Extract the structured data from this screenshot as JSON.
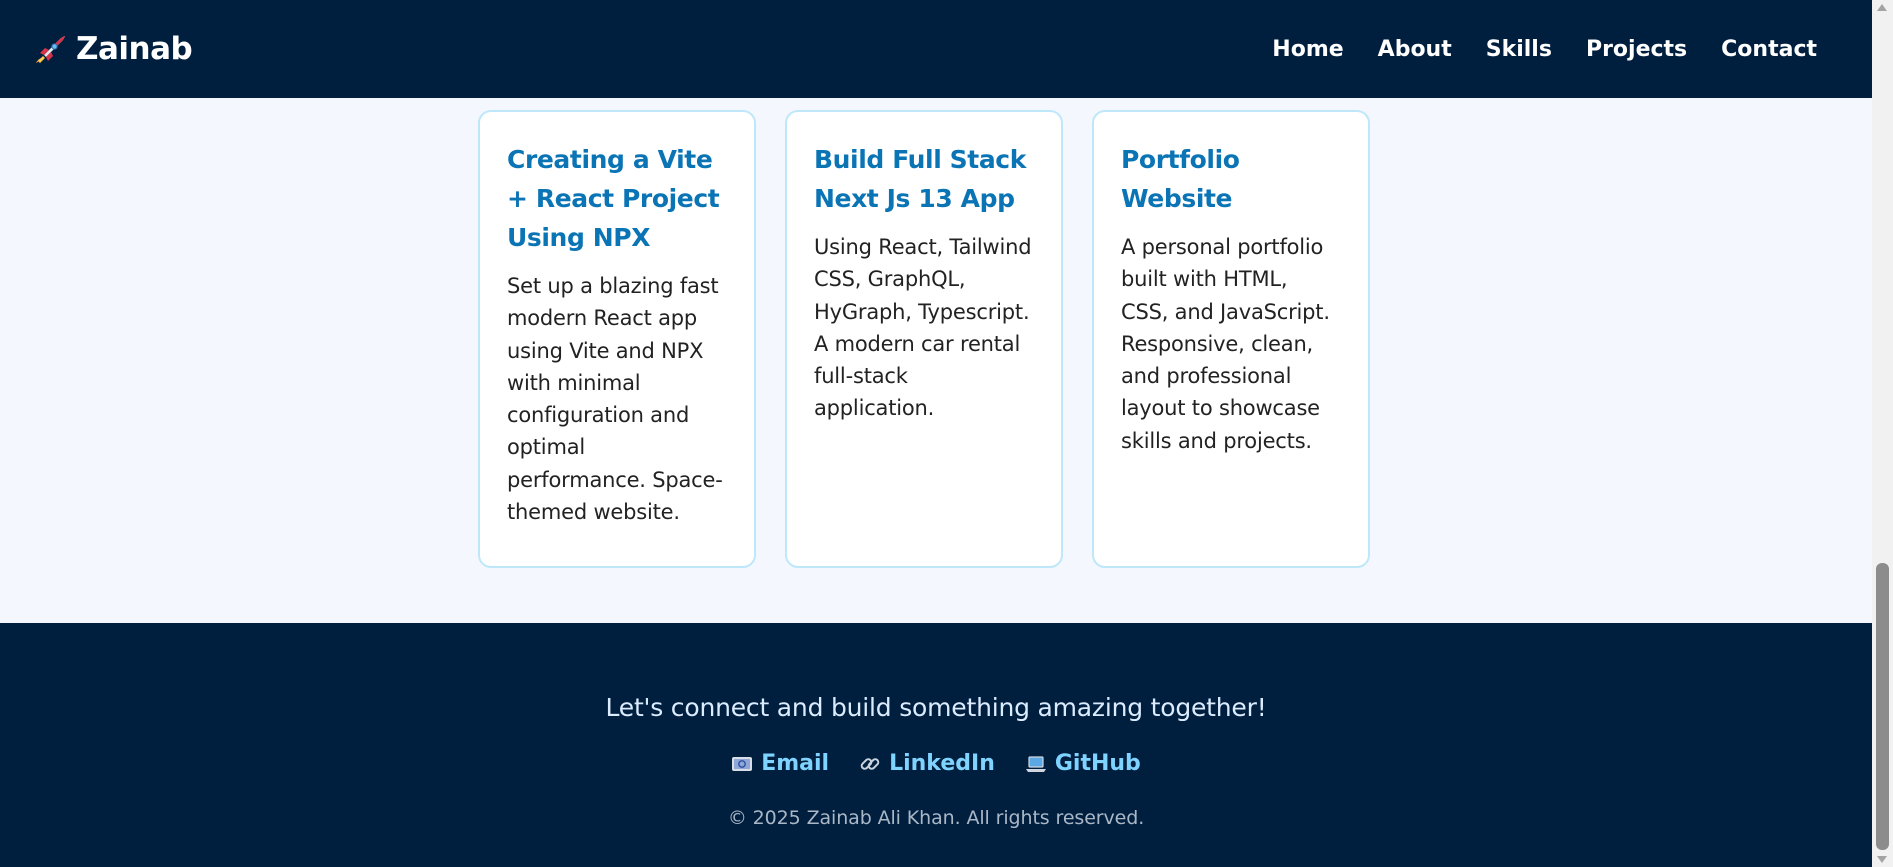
{
  "header": {
    "brand": {
      "name": "Zainab",
      "icon": "rocket-icon"
    },
    "nav": [
      "Home",
      "About",
      "Skills",
      "Projects",
      "Contact"
    ]
  },
  "projects": [
    {
      "title": "Creating a Vite + React Project Using NPX",
      "description": "Set up a blazing fast modern React app using Vite and NPX with minimal configuration and optimal performance. Space-themed website."
    },
    {
      "title": "Build Full Stack Next Js 13 App",
      "description": "Using React, Tailwind CSS, GraphQL, HyGraph, Typescript. A modern car rental full-stack application."
    },
    {
      "title": "Portfolio Website",
      "description": "A personal portfolio built with HTML, CSS, and JavaScript. Responsive, clean, and professional layout to showcase skills and projects."
    }
  ],
  "footer": {
    "tagline": "Let's connect and build something amazing together!",
    "links": [
      {
        "label": "Email",
        "icon": "email-icon"
      },
      {
        "label": "LinkedIn",
        "icon": "link-icon"
      },
      {
        "label": "GitHub",
        "icon": "laptop-icon"
      }
    ],
    "copyright": "© 2025 Zainab Ali Khan. All rights reserved."
  },
  "colors": {
    "navy": "#001f3f",
    "accent": "#0a74b5",
    "link": "#7fd3ff",
    "card_border": "#bfe7fa",
    "page_bg": "#f4f8fe"
  }
}
